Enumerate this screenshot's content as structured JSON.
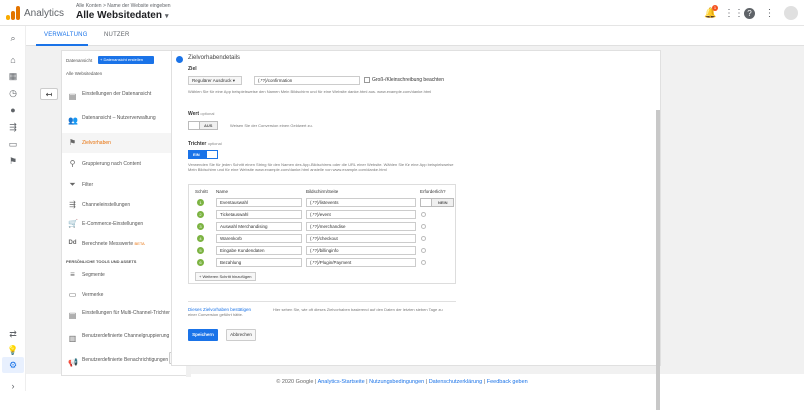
{
  "header": {
    "app_name": "Analytics",
    "account_crumb": "Alle Konten > Name der Website eingeben",
    "account_title": "Alle Websitedaten",
    "notification_count": "1"
  },
  "tabs": {
    "admin": "VERWALTUNG",
    "user": "NUTZER"
  },
  "admin_nav": {
    "dataview_label": "Datenansicht",
    "dataview_button": "Datenansicht erstellen",
    "dataview_name": "Alle Websitedaten",
    "items": [
      {
        "label": "Einstellungen der Datenansicht"
      },
      {
        "label": "Datenansicht – Nutzerverwaltung"
      },
      {
        "label": "Zielvorhaben"
      },
      {
        "label": "Gruppierung nach Content"
      },
      {
        "label": "Filter"
      },
      {
        "label": "Channeleinstellungen"
      },
      {
        "label": "E-Commerce-Einstellungen"
      },
      {
        "label": "Berechnete Messwerte",
        "badge": "BETA"
      }
    ],
    "section_title": "PERSÖNLICHE TOOLS UND ASSETS",
    "tools": [
      {
        "label": "Segmente"
      },
      {
        "label": "Vermerke"
      },
      {
        "label": "Einstellungen für Multi-Channel-Trichter"
      },
      {
        "label": "Benutzerdefinierte Channelgruppierung",
        "badge": "BETA"
      },
      {
        "label": "Benutzerdefinierte Benachrichtigungen"
      }
    ],
    "cancel_label": "Abbrechen"
  },
  "goal": {
    "section_title": "Zielvorhabendetails",
    "ziel_label": "Ziel",
    "match_type": "Regulärer Ausdruck",
    "url_value": "(.*?)/confirmation",
    "case_label": "Groß-/Kleinschreibung beachten",
    "ziel_help": "Wählen Sie für eine App beispielsweise den Namen Mein Bildschirm und für eine Website danke.html aus. www.example.com/danke.html",
    "wert_label": "Wert",
    "wert_optional": "optional",
    "wert_toggle": "AUS",
    "wert_help": "Weisen Sie der Conversion einen Geldwert zu.",
    "trichter_label": "Trichter",
    "trichter_optional": "optional",
    "trichter_toggle": "EIN",
    "trichter_help": "Verwenden Sie für jeden Schritt einen String für den Namen des App-Bildschirms oder die URL einer Website. Wählen Sie für eine App beispielsweise Mein Bildschirm und für eine Website www.example.com/danke.html anstelle von www.example.com/danke.html",
    "col_step": "Schritt",
    "col_name": "Name",
    "col_screen": "Bildschirm/Seite",
    "col_required": "Erforderlich?",
    "required_toggle": "NEIN",
    "steps": [
      {
        "num": "1",
        "name": "Eventauswahl",
        "page": "(.*?)/listevents"
      },
      {
        "num": "2",
        "name": "Ticketauswahl",
        "page": "(.*?)/event"
      },
      {
        "num": "3",
        "name": "Auswahl Merchandising",
        "page": "(.*?)/merchandise"
      },
      {
        "num": "4",
        "name": "Warenkorb",
        "page": "(.*?)/checkout"
      },
      {
        "num": "5",
        "name": "Eingabe Kundendaten",
        "page": "(.*?)/billinginfo"
      },
      {
        "num": "6",
        "name": "Bezahlung",
        "page": "(.*?)/Plugin/Payment"
      }
    ],
    "add_step": "+ Weiteren Schritt hinzufügen",
    "verify_link": "Dieses Zielvorhaben bestätigen",
    "verify_help": "Hier sehen Sie, wie oft dieses Zielvorhaben basierend auf den Daten der letzten sieben Tage zu einer Conversion geführt hätte.",
    "save": "Speichern",
    "cancel": "Abbrechen"
  },
  "footer": {
    "copyright": "© 2020 Google |",
    "links": [
      "Analytics-Startseite",
      "Nutzungsbedingungen",
      "Datenschutzerklärung",
      "Feedback geben"
    ]
  },
  "colors": {
    "accent": "#1a73e8",
    "orange": "#e8710a",
    "step_green": "#7cb342"
  }
}
